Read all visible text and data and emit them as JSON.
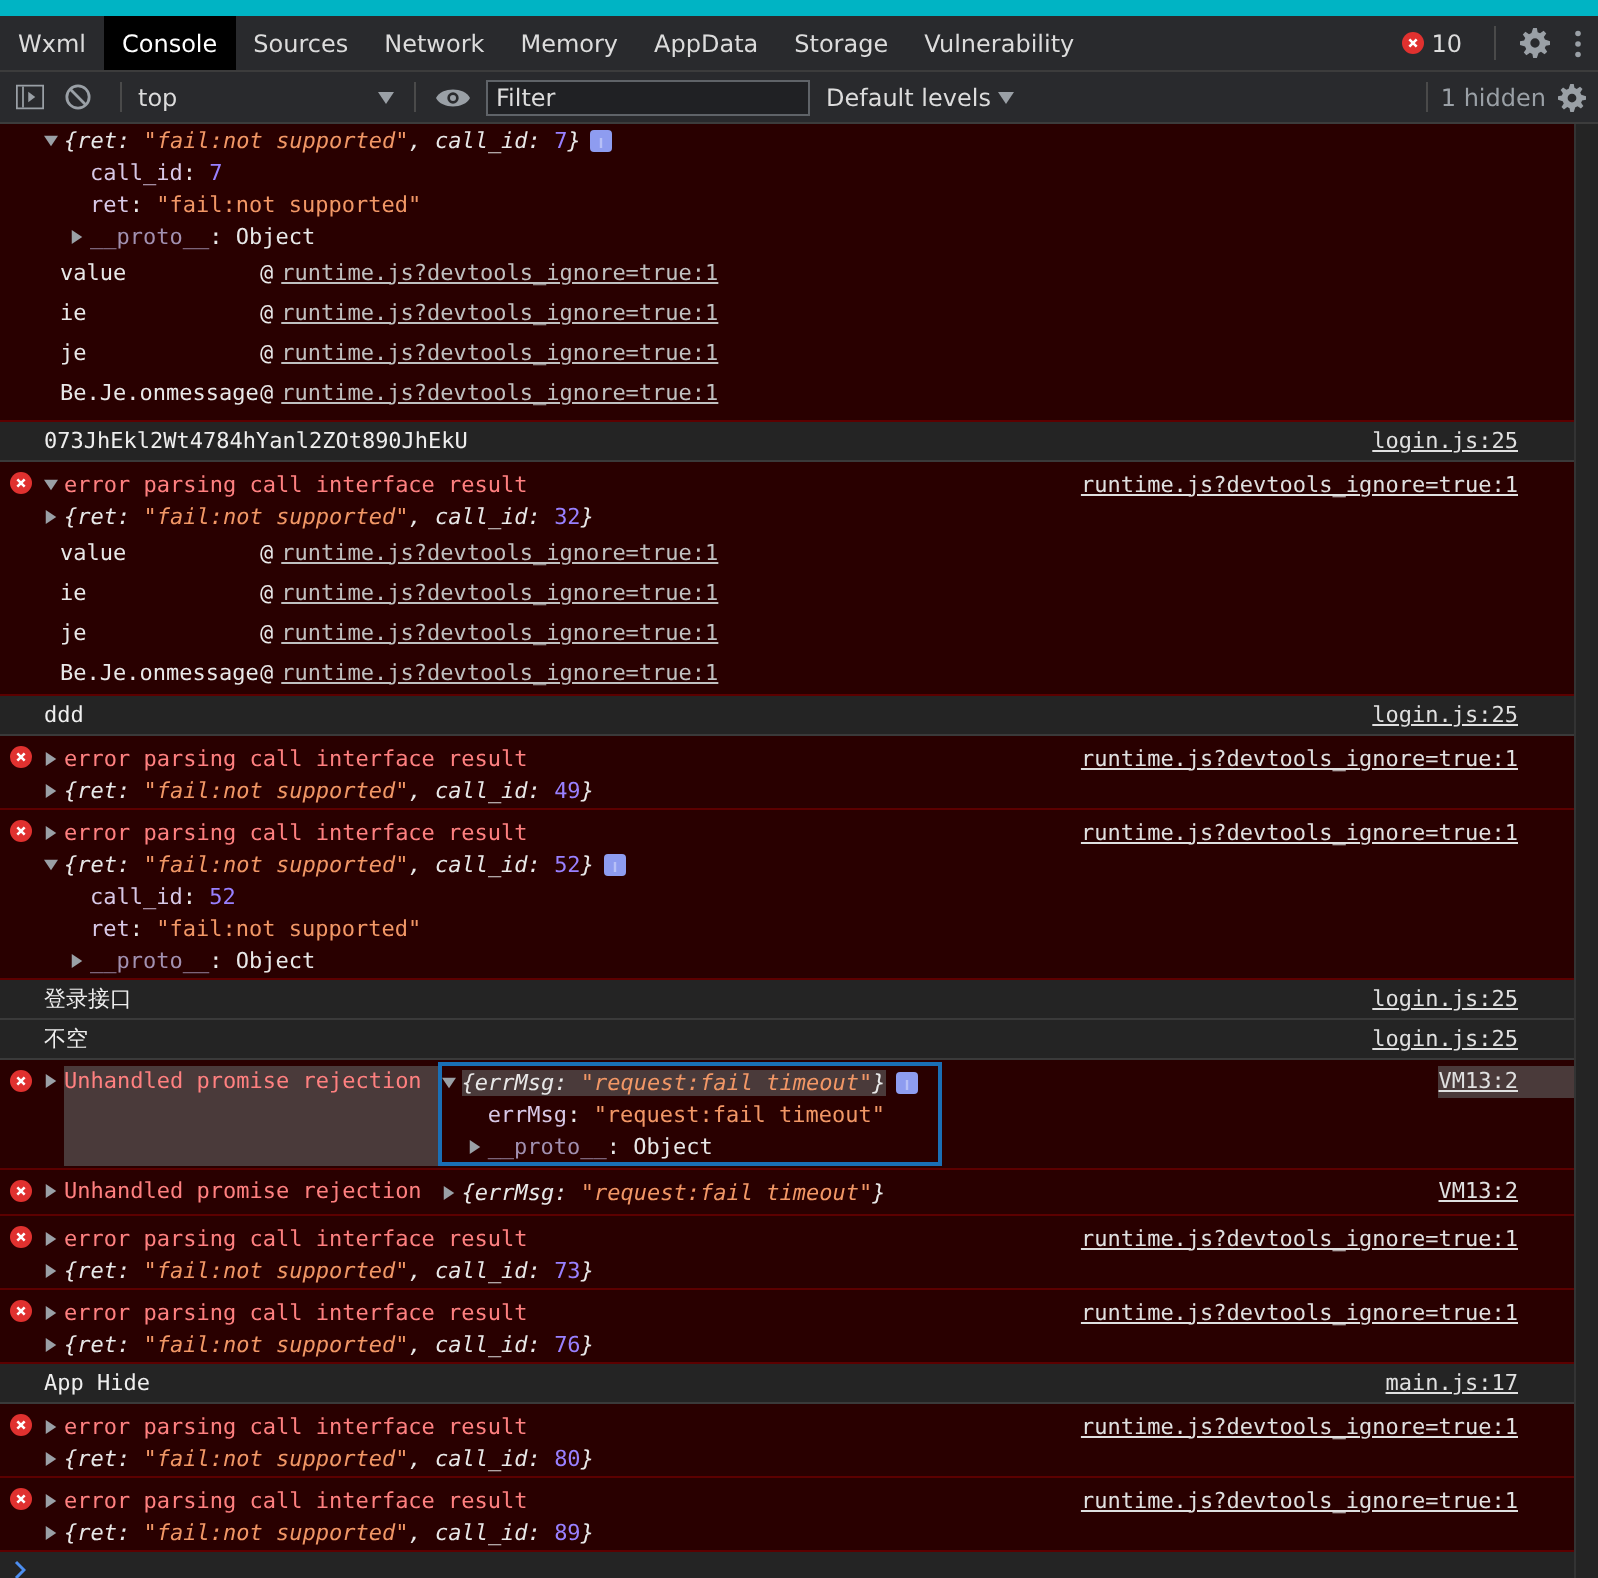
{
  "tabs": [
    {
      "label": "Wxml",
      "selected": false
    },
    {
      "label": "Console",
      "selected": true
    },
    {
      "label": "Sources",
      "selected": false
    },
    {
      "label": "Network",
      "selected": false
    },
    {
      "label": "Memory",
      "selected": false
    },
    {
      "label": "AppData",
      "selected": false
    },
    {
      "label": "Storage",
      "selected": false
    },
    {
      "label": "Vulnerability",
      "selected": false
    }
  ],
  "error_count": "10",
  "toolbar": {
    "context": "top",
    "filter": {
      "placeholder": "Filter"
    },
    "levels": "Default levels",
    "hidden": "1 hidden"
  },
  "messages": [
    {
      "kind": "error",
      "object": {
        "expanded": true,
        "info": true,
        "preview": [
          {
            "text": "{ret: ",
            "kind": "punct"
          },
          {
            "text": "\"fail:not supported\"",
            "kind": "string"
          },
          {
            "text": ", call_id: ",
            "kind": "punct"
          },
          {
            "text": "7",
            "kind": "number"
          },
          {
            "text": "}",
            "kind": "punct"
          }
        ],
        "properties": [
          {
            "kind": "leaf",
            "tokens": [
              {
                "text": "call_id",
                "kind": "key"
              },
              {
                "text": ": ",
                "kind": "punct"
              },
              {
                "text": "7",
                "kind": "number"
              }
            ]
          },
          {
            "kind": "leaf",
            "tokens": [
              {
                "text": "ret",
                "kind": "key"
              },
              {
                "text": ": ",
                "kind": "punct"
              },
              {
                "text": "\"fail:not supported\"",
                "kind": "string"
              }
            ]
          },
          {
            "kind": "proto",
            "expanded": false,
            "tokens": [
              {
                "text": "__proto__",
                "kind": "proto"
              },
              {
                "text": ": ",
                "kind": "punct"
              },
              {
                "text": "Object",
                "kind": "plain"
              }
            ]
          }
        ]
      },
      "stack": [
        {
          "function": "value",
          "at": "@",
          "link": "runtime.js?devtools_ignore=true:1"
        },
        {
          "function": "ie",
          "at": "@",
          "link": "runtime.js?devtools_ignore=true:1"
        },
        {
          "function": "je",
          "at": "@",
          "link": "runtime.js?devtools_ignore=true:1"
        },
        {
          "function": "Be.Je.onmessage",
          "at": "@",
          "link": "runtime.js?devtools_ignore=true:1"
        }
      ]
    },
    {
      "kind": "log",
      "text": "073JhEkl2Wt4784hYanl2ZOt890JhEkU",
      "source": "login.js:25"
    },
    {
      "kind": "error",
      "message": "error parsing call interface result",
      "message_expanded": true,
      "source": "runtime.js?devtools_ignore=true:1",
      "object": {
        "expanded": false,
        "info": false,
        "preview": [
          {
            "text": "{ret: ",
            "kind": "punct"
          },
          {
            "text": "\"fail:not supported\"",
            "kind": "string"
          },
          {
            "text": ", call_id: ",
            "kind": "punct"
          },
          {
            "text": "32",
            "kind": "number"
          },
          {
            "text": "}",
            "kind": "punct"
          }
        ]
      },
      "stack": [
        {
          "function": "value",
          "at": "@",
          "link": "runtime.js?devtools_ignore=true:1"
        },
        {
          "function": "ie",
          "at": "@",
          "link": "runtime.js?devtools_ignore=true:1"
        },
        {
          "function": "je",
          "at": "@",
          "link": "runtime.js?devtools_ignore=true:1"
        },
        {
          "function": "Be.Je.onmessage",
          "at": "@",
          "link": "runtime.js?devtools_ignore=true:1"
        }
      ]
    },
    {
      "kind": "log",
      "text": "ddd",
      "source": "login.js:25"
    },
    {
      "kind": "error",
      "message": "error parsing call interface result",
      "message_expanded": false,
      "source": "runtime.js?devtools_ignore=true:1",
      "object": {
        "expanded": false,
        "info": false,
        "preview": [
          {
            "text": "{ret: ",
            "kind": "punct"
          },
          {
            "text": "\"fail:not supported\"",
            "kind": "string"
          },
          {
            "text": ", call_id: ",
            "kind": "punct"
          },
          {
            "text": "49",
            "kind": "number"
          },
          {
            "text": "}",
            "kind": "punct"
          }
        ]
      }
    },
    {
      "kind": "error",
      "message": "error parsing call interface result",
      "message_expanded": false,
      "source": "runtime.js?devtools_ignore=true:1",
      "object": {
        "expanded": true,
        "info": true,
        "preview": [
          {
            "text": "{ret: ",
            "kind": "punct"
          },
          {
            "text": "\"fail:not supported\"",
            "kind": "string"
          },
          {
            "text": ", call_id: ",
            "kind": "punct"
          },
          {
            "text": "52",
            "kind": "number"
          },
          {
            "text": "}",
            "kind": "punct"
          }
        ],
        "properties": [
          {
            "kind": "leaf",
            "tokens": [
              {
                "text": "call_id",
                "kind": "key"
              },
              {
                "text": ": ",
                "kind": "punct"
              },
              {
                "text": "52",
                "kind": "number"
              }
            ]
          },
          {
            "kind": "leaf",
            "tokens": [
              {
                "text": "ret",
                "kind": "key"
              },
              {
                "text": ": ",
                "kind": "punct"
              },
              {
                "text": "\"fail:not supported\"",
                "kind": "string"
              }
            ]
          },
          {
            "kind": "proto",
            "expanded": false,
            "tokens": [
              {
                "text": "__proto__",
                "kind": "proto"
              },
              {
                "text": ": ",
                "kind": "punct"
              },
              {
                "text": "Object",
                "kind": "plain"
              }
            ]
          }
        ]
      }
    },
    {
      "kind": "log",
      "text": "登录接口",
      "source": "login.js:25"
    },
    {
      "kind": "log",
      "text": "不空",
      "source": "login.js:25"
    },
    {
      "kind": "rejection",
      "selected": true,
      "message": "Unhandled promise rejection",
      "message_expanded": false,
      "source": "VM13:2",
      "object": {
        "expanded": true,
        "info": true,
        "preview": [
          {
            "text": "{errMsg: ",
            "kind": "punct"
          },
          {
            "text": "\"request:fail timeout\"",
            "kind": "string"
          },
          {
            "text": "}",
            "kind": "punct"
          }
        ],
        "properties": [
          {
            "kind": "leaf",
            "tokens": [
              {
                "text": "errMsg",
                "kind": "key"
              },
              {
                "text": ": ",
                "kind": "punct"
              },
              {
                "text": "\"request:fail timeout\"",
                "kind": "string"
              }
            ]
          },
          {
            "kind": "proto",
            "expanded": false,
            "tokens": [
              {
                "text": "__proto__",
                "kind": "proto"
              },
              {
                "text": ": ",
                "kind": "punct"
              },
              {
                "text": "Object",
                "kind": "plain"
              }
            ]
          }
        ]
      }
    },
    {
      "kind": "rejection",
      "selected": false,
      "message": "Unhandled promise rejection",
      "message_expanded": false,
      "source": "VM13:2",
      "object": {
        "expanded": false,
        "info": false,
        "preview": [
          {
            "text": "{errMsg: ",
            "kind": "punct"
          },
          {
            "text": "\"request:fail timeout\"",
            "kind": "string"
          },
          {
            "text": "}",
            "kind": "punct"
          }
        ]
      }
    },
    {
      "kind": "error",
      "message": "error parsing call interface result",
      "message_expanded": false,
      "source": "runtime.js?devtools_ignore=true:1",
      "object": {
        "expanded": false,
        "info": false,
        "preview": [
          {
            "text": "{ret: ",
            "kind": "punct"
          },
          {
            "text": "\"fail:not supported\"",
            "kind": "string"
          },
          {
            "text": ", call_id: ",
            "kind": "punct"
          },
          {
            "text": "73",
            "kind": "number"
          },
          {
            "text": "}",
            "kind": "punct"
          }
        ]
      }
    },
    {
      "kind": "error",
      "message": "error parsing call interface result",
      "message_expanded": false,
      "source": "runtime.js?devtools_ignore=true:1",
      "object": {
        "expanded": false,
        "info": false,
        "preview": [
          {
            "text": "{ret: ",
            "kind": "punct"
          },
          {
            "text": "\"fail:not supported\"",
            "kind": "string"
          },
          {
            "text": ", call_id: ",
            "kind": "punct"
          },
          {
            "text": "76",
            "kind": "number"
          },
          {
            "text": "}",
            "kind": "punct"
          }
        ]
      }
    },
    {
      "kind": "log",
      "text": "App Hide",
      "source": "main.js:17"
    },
    {
      "kind": "error",
      "message": "error parsing call interface result",
      "message_expanded": false,
      "source": "runtime.js?devtools_ignore=true:1",
      "object": {
        "expanded": false,
        "info": false,
        "preview": [
          {
            "text": "{ret: ",
            "kind": "punct"
          },
          {
            "text": "\"fail:not supported\"",
            "kind": "string"
          },
          {
            "text": ", call_id: ",
            "kind": "punct"
          },
          {
            "text": "80",
            "kind": "number"
          },
          {
            "text": "}",
            "kind": "punct"
          }
        ]
      }
    },
    {
      "kind": "error",
      "message": "error parsing call interface result",
      "message_expanded": false,
      "source": "runtime.js?devtools_ignore=true:1",
      "object": {
        "expanded": false,
        "info": false,
        "preview": [
          {
            "text": "{ret: ",
            "kind": "punct"
          },
          {
            "text": "\"fail:not supported\"",
            "kind": "string"
          },
          {
            "text": ", call_id: ",
            "kind": "punct"
          },
          {
            "text": "89",
            "kind": "number"
          },
          {
            "text": "}",
            "kind": "punct"
          }
        ]
      }
    }
  ]
}
